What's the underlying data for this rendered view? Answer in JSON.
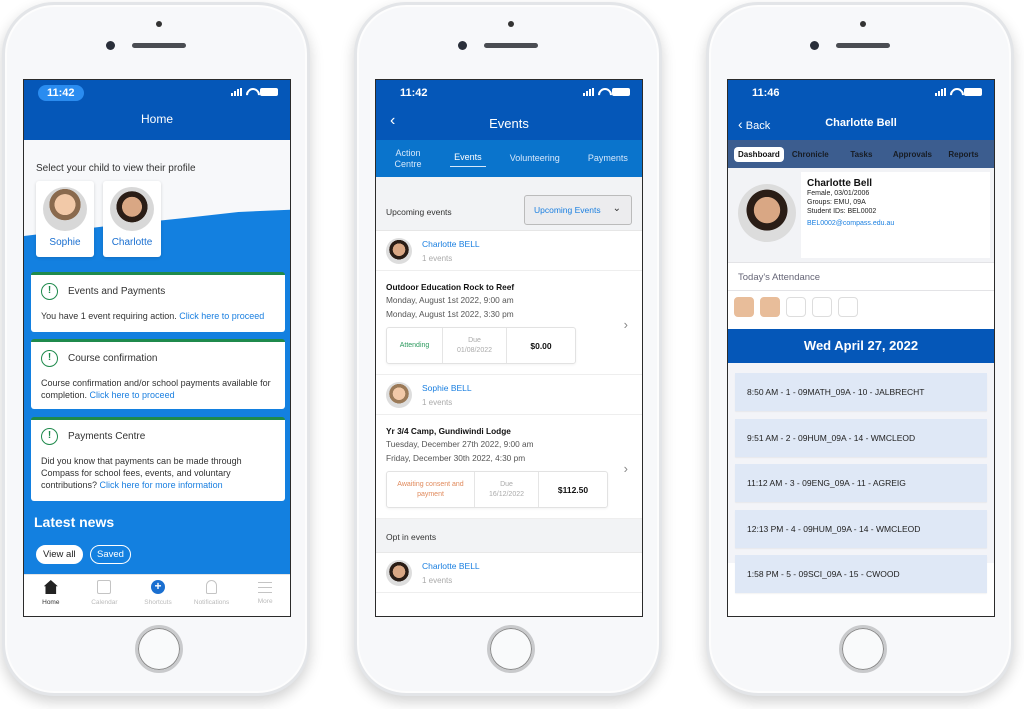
{
  "phones": {
    "home": {
      "status_time": "11:42",
      "title": "Home",
      "select_prompt": "Select your child to view their profile",
      "children": [
        {
          "name": "Sophie"
        },
        {
          "name": "Charlotte"
        }
      ],
      "alerts": [
        {
          "title": "Events and Payments",
          "text": "You have 1 event requiring action. ",
          "link": "Click here to proceed"
        },
        {
          "title": "Course confirmation",
          "text": "Course confirmation and/or school payments available for completion. ",
          "link": "Click here to proceed"
        },
        {
          "title": "Payments Centre",
          "text": "Did you know that payments can be made through Compass for school fees, events, and voluntary contributions? ",
          "link": "Click here for more information"
        }
      ],
      "news_title": "Latest news",
      "news_filters": {
        "all": "View all",
        "saved": "Saved"
      },
      "tabbar": [
        {
          "label": "Home",
          "icon": "home-icon",
          "active": true
        },
        {
          "label": "Calendar",
          "icon": "calendar-icon"
        },
        {
          "label": "Shortcuts",
          "icon": "plus-circle-icon"
        },
        {
          "label": "Notifications",
          "icon": "bell-icon"
        },
        {
          "label": "More",
          "icon": "menu-icon"
        }
      ]
    },
    "events": {
      "status_time": "11:42",
      "title": "Events",
      "back_icon": "chevron-left-icon",
      "tabs": [
        {
          "label": "Action Centre"
        },
        {
          "label": "Events",
          "active": true
        },
        {
          "label": "Volunteering"
        },
        {
          "label": "Payments"
        }
      ],
      "section_label": "Upcoming events",
      "filter_value": "Upcoming Events",
      "groups": [
        {
          "student": "Charlotte BELL",
          "count": "1 events",
          "event": {
            "title": "Outdoor Education Rock to Reef",
            "start": "Monday, August 1st 2022, 9:00 am",
            "end": "Monday, August 1st 2022, 3:30 pm",
            "status": "Attending",
            "due_label": "Due",
            "due_date": "01/08/2022",
            "amount": "$0.00"
          }
        },
        {
          "student": "Sophie BELL",
          "count": "1 events",
          "event": {
            "title": "Yr 3/4 Camp, Gundiwindi Lodge",
            "start": "Tuesday, December 27th 2022, 9:00 am",
            "end": "Friday, December 30th 2022, 4:30 pm",
            "status": "Awaiting consent and payment",
            "due_label": "Due",
            "due_date": "16/12/2022",
            "amount": "$112.50"
          }
        }
      ],
      "optin_label": "Opt in events",
      "optin_student": {
        "student": "Charlotte BELL",
        "count": "1 events"
      }
    },
    "profile": {
      "status_time": "11:46",
      "back_label": "Back",
      "title": "Charlotte Bell",
      "segments": [
        {
          "label": "Dashboard",
          "active": true
        },
        {
          "label": "Chronicle"
        },
        {
          "label": "Tasks"
        },
        {
          "label": "Approvals"
        },
        {
          "label": "Reports"
        }
      ],
      "student": {
        "name": "Charlotte Bell",
        "details": "Female, 03/01/2006",
        "groups": "Groups: EMU, 09A",
        "ids": "Student IDs: BEL0002",
        "email": "BEL0002@compass.edu.au"
      },
      "attendance_label": "Today's Attendance",
      "attendance": [
        "marked",
        "marked",
        "empty",
        "empty",
        "empty"
      ],
      "date": "Wed April 27, 2022",
      "classes": [
        "8:50 AM - 1 - 09MATH_09A - 10 - JALBRECHT",
        "9:51 AM - 2 - 09HUM_09A - 14 - WMCLEOD",
        "11:12 AM - 3 - 09ENG_09A - 11 - AGREIG",
        "12:13 PM - 4 - 09HUM_09A - 14 - WMCLEOD",
        "1:58 PM - 5 - 09SCI_09A - 15 - CWOOD"
      ]
    }
  },
  "colors": {
    "brand_blue": "#0557b8",
    "accent_blue": "#1380e0",
    "link_blue": "#1a7fe0",
    "alert_green": "#1f8a4c",
    "warning_orange": "#e08a5c",
    "attendance_marked": "#e8bd9a"
  }
}
